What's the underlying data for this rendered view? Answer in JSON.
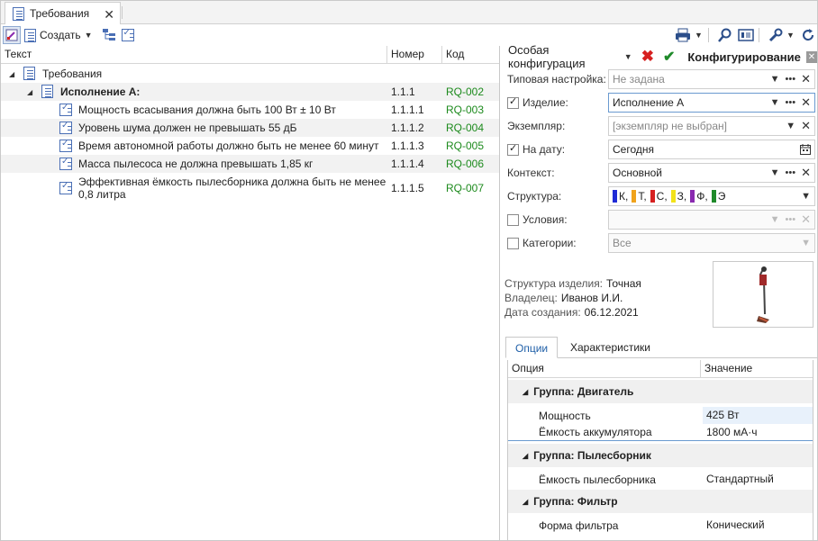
{
  "tab": {
    "title": "Требования",
    "close": "✕"
  },
  "toolbar": {
    "create_label": "Создать"
  },
  "tree": {
    "columns": [
      "Текст",
      "Номер",
      "Код"
    ],
    "root_label": "Требования",
    "group": {
      "text": "Исполнение А:",
      "num": "1.1.1",
      "code": "RQ-002"
    },
    "items": [
      {
        "text": "Мощность всасывания должна быть 100 Вт ± 10 Вт",
        "num": "1.1.1.1",
        "code": "RQ-003"
      },
      {
        "text": "Уровень шума должен не превышать 55 дБ",
        "num": "1.1.1.2",
        "code": "RQ-004"
      },
      {
        "text": "Время автономной работы должно быть не менее 60 минут",
        "num": "1.1.1.3",
        "code": "RQ-005"
      },
      {
        "text": "Масса пылесоса не должна превышать 1,85 кг",
        "num": "1.1.1.4",
        "code": "RQ-006"
      },
      {
        "text": "Эффективная ёмкость пылесборника должна быть не менее",
        "text2": "0,8 литра",
        "num": "1.1.1.5",
        "code": "RQ-007"
      }
    ]
  },
  "config": {
    "mode": "Особая конфигурация",
    "title": "Конфигурирование",
    "fields": {
      "typical": {
        "label": "Типовая настройка:",
        "value": "Не задана"
      },
      "product": {
        "label": "Изделие:",
        "value": "Исполнение А"
      },
      "instance": {
        "label": "Экземпляр:",
        "value": "[экземпляр не выбран]"
      },
      "date": {
        "label": "На дату:",
        "value": "Сегодня"
      },
      "context": {
        "label": "Контекст:",
        "value": "Основной"
      },
      "structure": {
        "label": "Структура:"
      },
      "conditions": {
        "label": "Условия:"
      },
      "categories": {
        "label": "Категории:",
        "value": "Все"
      }
    },
    "structure_tags": [
      {
        "label": "К,",
        "color": "#1f2bd6"
      },
      {
        "label": "Т,",
        "color": "#f0a31c"
      },
      {
        "label": "С,",
        "color": "#d62020"
      },
      {
        "label": "З,",
        "color": "#f2e21a"
      },
      {
        "label": "Ф,",
        "color": "#8a2ab0"
      },
      {
        "label": "Э",
        "color": "#1f8a2a"
      }
    ],
    "info": {
      "structure_label": "Структура изделия:",
      "structure_value": "Точная",
      "owner_label": "Владелец:",
      "owner_value": "Иванов И.И.",
      "created_label": "Дата создания:",
      "created_value": "06.12.2021"
    },
    "tabs": [
      "Опции",
      "Характеристики"
    ],
    "options": {
      "columns": [
        "Опция",
        "Значение"
      ],
      "groups": [
        {
          "name": "Группа: Двигатель",
          "rows": [
            {
              "name": "Мощность",
              "value": "425 Вт"
            },
            {
              "name": "Ёмкость аккумулятора",
              "value": "1800 мА·ч"
            }
          ]
        },
        {
          "name": "Группа: Пылесборник",
          "rows": [
            {
              "name": "Ёмкость пылесборника",
              "value": "Стандартный"
            }
          ]
        },
        {
          "name": "Группа: Фильтр",
          "rows": [
            {
              "name": "Форма фильтра",
              "value": "Конический"
            }
          ]
        }
      ]
    }
  }
}
